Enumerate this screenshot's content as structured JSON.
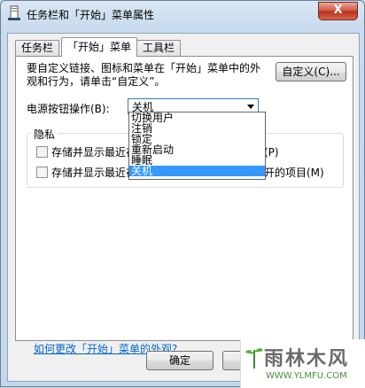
{
  "window": {
    "title": "任务栏和「开始」菜单属性",
    "close_glyph": "X"
  },
  "tabs": [
    {
      "label": "任务栏"
    },
    {
      "label": "「开始」菜单"
    },
    {
      "label": "工具栏"
    }
  ],
  "start_menu": {
    "description": "要自定义链接、图标和菜单在「开始」菜单中的外观和行为，请单击“自定义”。",
    "customize_button": "自定义(C)...",
    "power_label": "电源按钮操作(B):",
    "power_value": "关机",
    "power_options": [
      "切换用户",
      "注销",
      "锁定",
      "重新启动",
      "睡眠",
      "关机"
    ],
    "privacy": {
      "title": "隐私",
      "option1": "存储并显示最近在「开始」菜单中打开的程序(P)",
      "option2": "存储并显示最近在「开始」菜单和任务栏中打开的项目(M)",
      "option1_visible_tail": "(P)",
      "option2_visible_tail": "开的项目(M)"
    },
    "help_link": "如何更改「开始」菜单的外观?"
  },
  "footer": {
    "ok_label": "确定",
    "cancel_label": "取"
  },
  "watermark": {
    "text": "雨林木风",
    "url": "WWW.YLMFU.COM"
  }
}
